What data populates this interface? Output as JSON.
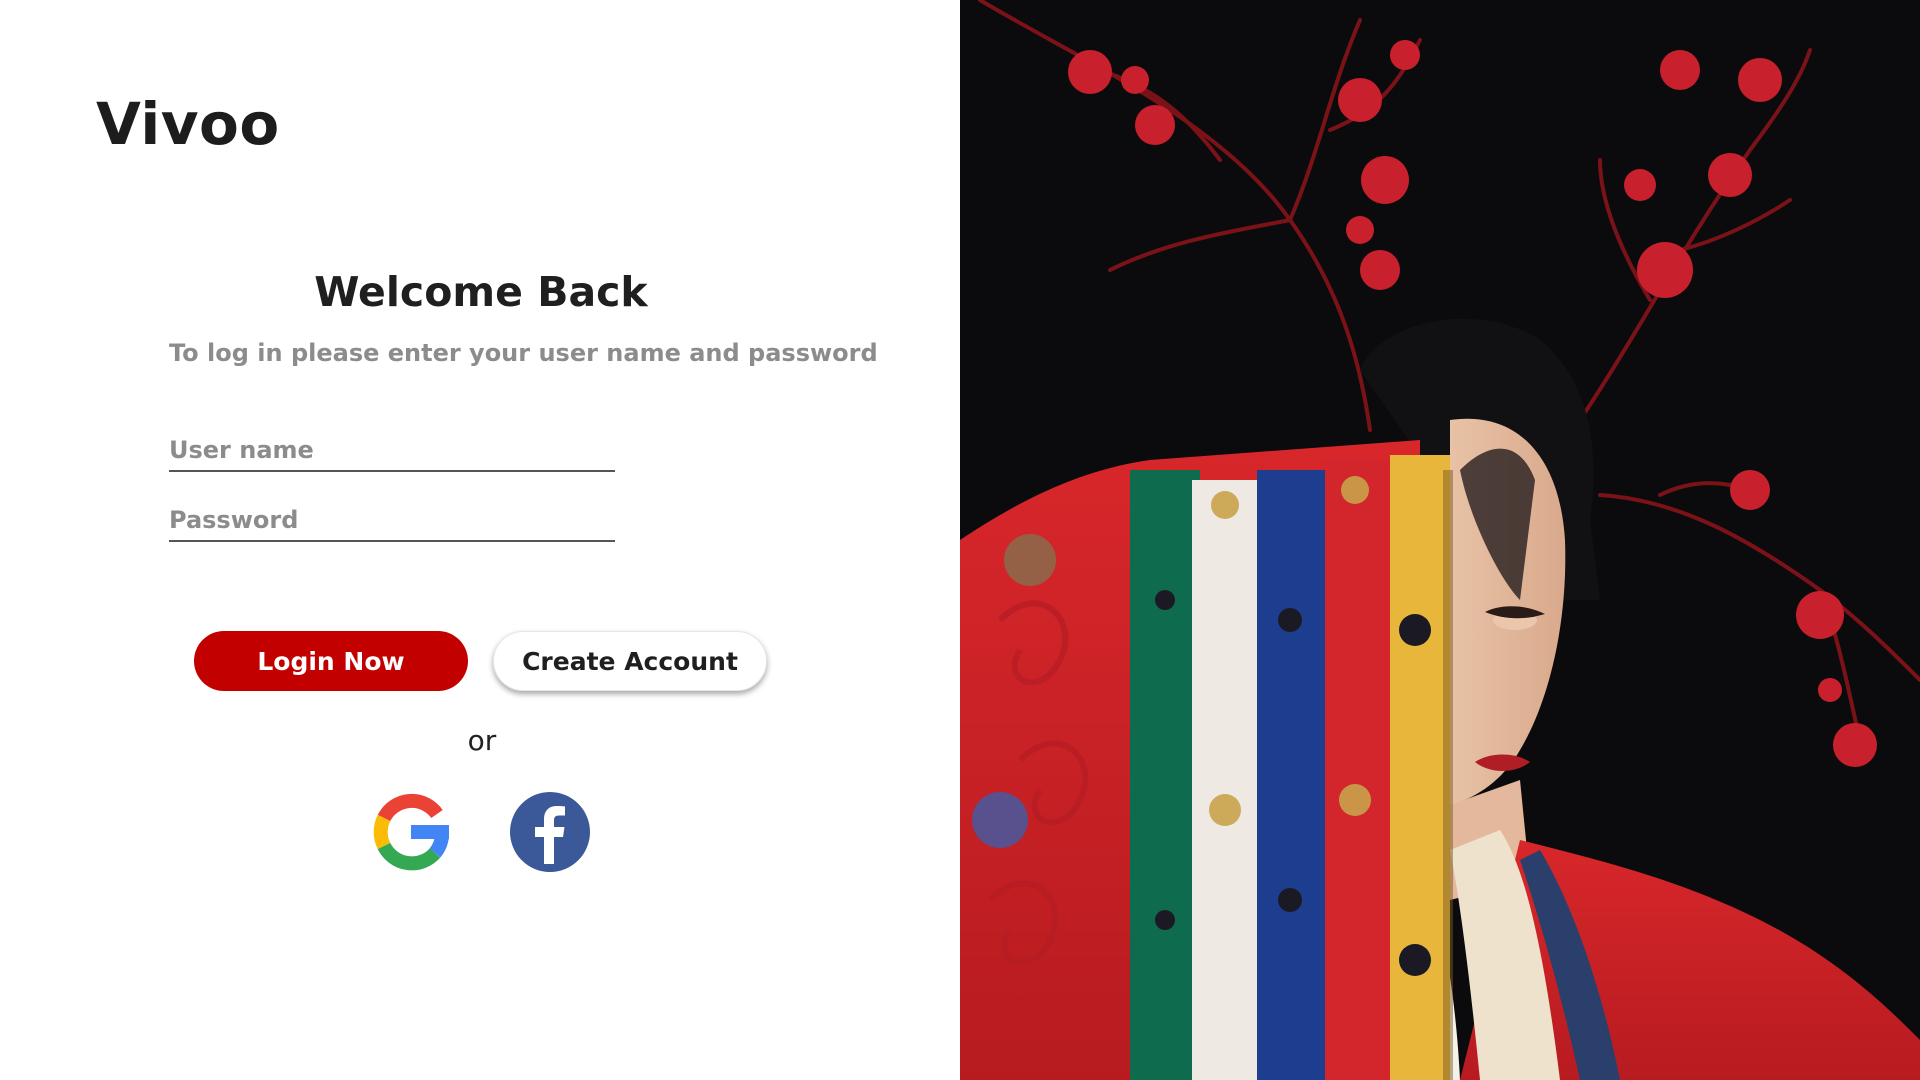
{
  "brand": {
    "name": "Vivoo"
  },
  "login": {
    "title": "Welcome Back",
    "subtitle": "To log in please enter your user name and password",
    "username_placeholder": "User name",
    "password_placeholder": "Password",
    "login_button": "Login Now",
    "create_button": "Create Account",
    "or_text": "or"
  },
  "social": {
    "google_icon": "google-icon",
    "facebook_icon": "facebook-icon"
  },
  "colors": {
    "accent": "#c30000",
    "text_dark": "#1f1f1f",
    "text_muted": "#8c8c8c",
    "facebook_blue": "#3b5998",
    "photo_background": "#0b0b0d"
  }
}
